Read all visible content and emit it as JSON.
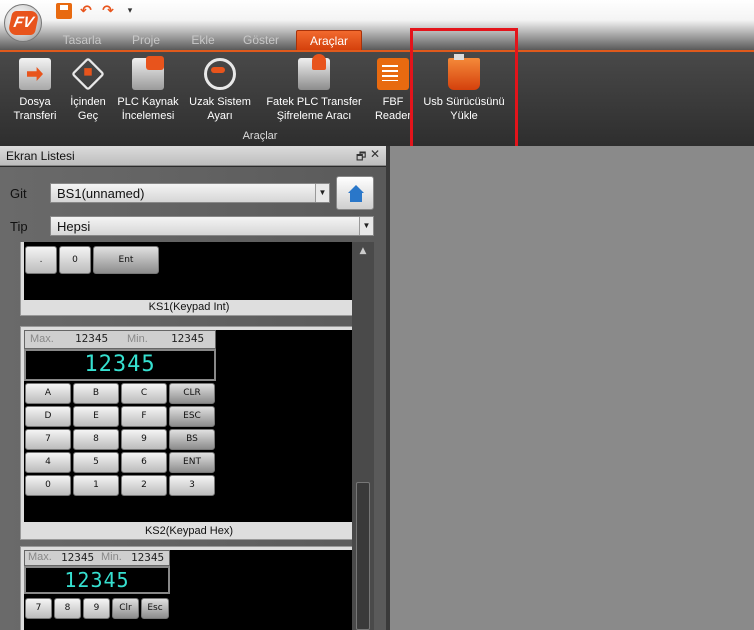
{
  "app": {
    "logo_text": "FV"
  },
  "quick_access": {
    "save_icon": "save-icon",
    "undo_icon": "undo-icon",
    "redo_icon": "redo-icon",
    "more_glyph": "▾"
  },
  "tabs": [
    {
      "label": "Tasarla"
    },
    {
      "label": "Proje"
    },
    {
      "label": "Ekle"
    },
    {
      "label": "Göster"
    },
    {
      "label": "Araçlar",
      "active": true
    }
  ],
  "ribbon": {
    "group_label": "Araçlar",
    "buttons": [
      {
        "line1": "Dosya",
        "line2": "Transferi",
        "icon": "file-transfer-icon"
      },
      {
        "line1": "İçinden",
        "line2": "Geç",
        "icon": "pass-through-icon"
      },
      {
        "line1": "PLC Kaynak",
        "line2": "İncelemesi",
        "icon": "plc-resource-icon"
      },
      {
        "line1": "Uzak Sistem",
        "line2": "Ayarı",
        "icon": "remote-system-icon"
      },
      {
        "line1": "Fatek PLC Transfer",
        "line2": "Şifreleme Aracı",
        "icon": "fatek-encrypt-icon"
      },
      {
        "line1": "FBF",
        "line2": "Reader",
        "icon": "fbf-reader-icon"
      },
      {
        "line1": "Usb Sürücüsünü",
        "line2": "Yükle",
        "icon": "usb-driver-icon"
      }
    ],
    "highlight_color": "#e3141b"
  },
  "panel": {
    "title": "Ekran Listesi",
    "git_label": "Git",
    "git_value": "BS1(unnamed)",
    "tip_label": "Tip",
    "tip_value": "Hepsi"
  },
  "previews": {
    "ks1": {
      "caption": "KS1(Keypad Int)",
      "keys": [
        ".",
        "0",
        "Ent"
      ]
    },
    "ks2": {
      "caption": "KS2(Keypad Hex)",
      "max_label": "Max.",
      "min_label": "Min.",
      "max_value": "12345",
      "min_value": "12345",
      "display_value": "12345",
      "keys": [
        [
          "A",
          "B",
          "C",
          "CLR"
        ],
        [
          "D",
          "E",
          "F",
          "ESC"
        ],
        [
          "7",
          "8",
          "9",
          "BS"
        ],
        [
          "4",
          "5",
          "6",
          "ENT"
        ],
        [
          "0",
          "1",
          "2",
          "3"
        ]
      ]
    },
    "ks3": {
      "max_label": "Max.",
      "min_label": "Min.",
      "max_value": "12345",
      "min_value": "12345",
      "display_value": "12345",
      "keys": [
        "7",
        "8",
        "9",
        "Clr",
        "Esc"
      ]
    }
  },
  "colors": {
    "accent": "#e8541c",
    "lcd_text": "#36e0d0"
  }
}
